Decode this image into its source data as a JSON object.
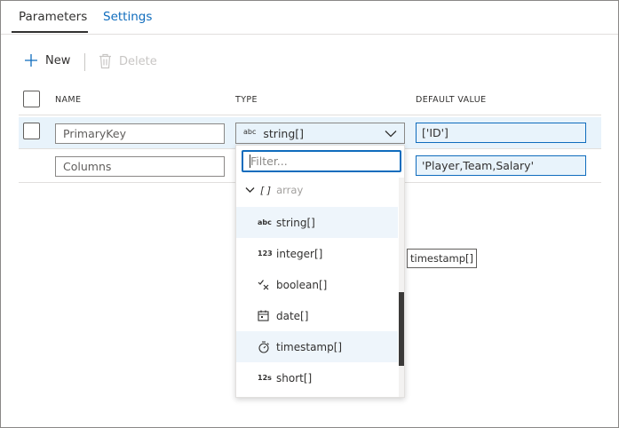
{
  "tabs": [
    {
      "label": "Parameters",
      "active": true
    },
    {
      "label": "Settings",
      "active": false
    }
  ],
  "toolbar": {
    "new_label": "New",
    "delete_label": "Delete"
  },
  "columns": {
    "name": "NAME",
    "type": "TYPE",
    "default": "DEFAULT VALUE"
  },
  "rows": [
    {
      "name": "PrimaryKey",
      "type": "string[]",
      "type_icon": "abc",
      "default": "['ID']",
      "selected": true
    },
    {
      "name": "Columns",
      "default": "'Player,Team,Salary'"
    }
  ],
  "dropdown": {
    "filter_placeholder": "Filter...",
    "group_label": "array",
    "group_bracket": "[ ]",
    "options": [
      {
        "icon": "abc",
        "label": "string[]"
      },
      {
        "icon": "123",
        "label": "integer[]"
      },
      {
        "icon": "boolean-icon",
        "label": "boolean[]"
      },
      {
        "icon": "calendar-icon",
        "label": "date[]"
      },
      {
        "icon": "stopwatch-icon",
        "label": "timestamp[]"
      },
      {
        "icon": "12s",
        "label": "short[]"
      }
    ]
  },
  "tooltip": "timestamp[]",
  "colors": {
    "accent": "#0f6cbd",
    "row_selected": "#e8f3fb"
  }
}
